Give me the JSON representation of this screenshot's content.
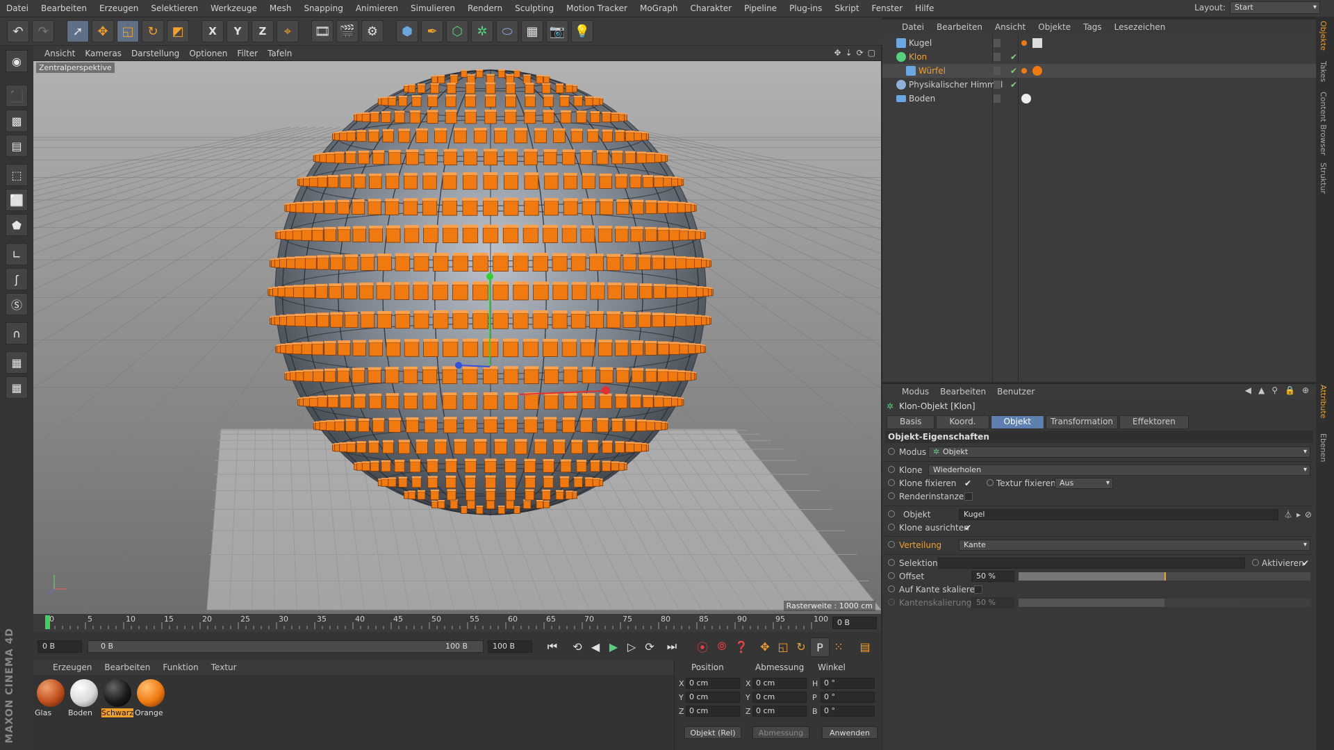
{
  "menubar": {
    "items": [
      "Datei",
      "Bearbeiten",
      "Erzeugen",
      "Selektieren",
      "Werkzeuge",
      "Mesh",
      "Snapping",
      "Animieren",
      "Simulieren",
      "Rendern",
      "Sculpting",
      "Motion Tracker",
      "MoGraph",
      "Charakter",
      "Pipeline",
      "Plug-ins",
      "Skript",
      "Fenster",
      "Hilfe"
    ],
    "layout_label": "Layout:",
    "layout_value": "Start"
  },
  "toolbar": {
    "icons": [
      "undo-icon",
      "redo-icon",
      "live-select-icon",
      "move-icon",
      "scale-icon",
      "rotate-icon",
      "recent-tool-icon",
      "x-axis-icon",
      "y-axis-icon",
      "z-axis-icon",
      "coordinate-system-icon",
      "render-view-icon",
      "render-picture-viewer-icon",
      "edit-render-settings-icon",
      "cube-icon",
      "pen-icon",
      "subdivision-icon",
      "cloner-icon",
      "deformer-icon",
      "floor-icon",
      "camera-icon",
      "light-icon"
    ],
    "axis_x": "X",
    "axis_y": "Y",
    "axis_z": "Z"
  },
  "viewport": {
    "menu": [
      "Ansicht",
      "Kameras",
      "Darstellung",
      "Optionen",
      "Filter",
      "Tafeln"
    ],
    "label": "Zentralperspektive",
    "raster": "Rasterweite : 1000 cm",
    "accent": "#f07a10",
    "axis_colors": {
      "x": "#e03030",
      "y": "#30d030",
      "z": "#3050e0"
    }
  },
  "timeline": {
    "ticks": [
      "0",
      "5",
      "10",
      "15",
      "20",
      "25",
      "30",
      "35",
      "40",
      "45",
      "50",
      "55",
      "60",
      "65",
      "70",
      "75",
      "80",
      "85",
      "90",
      "95",
      "100"
    ],
    "current_frame_box": "0 B",
    "start_field": "0 B",
    "range_start": "0 B",
    "range_end": "100 B",
    "end_field": "100 B"
  },
  "material_manager": {
    "menu": [
      "Erzeugen",
      "Bearbeiten",
      "Funktion",
      "Textur"
    ],
    "materials": [
      {
        "name": "Glas",
        "color": "#c0501c",
        "selected": false
      },
      {
        "name": "Boden",
        "color": "#e8e8e8",
        "selected": false
      },
      {
        "name": "Schwarz",
        "color": "#1a1a1a",
        "selected": true
      },
      {
        "name": "Orange",
        "color": "#f07a10",
        "selected": false
      }
    ]
  },
  "coordinates": {
    "headers": [
      "Position",
      "Abmessung",
      "Winkel"
    ],
    "rows": [
      {
        "a": "X",
        "av": "0 cm",
        "b": "X",
        "bv": "0 cm",
        "c": "H",
        "cv": "0 °"
      },
      {
        "a": "Y",
        "av": "0 cm",
        "b": "Y",
        "bv": "0 cm",
        "c": "P",
        "cv": "0 °"
      },
      {
        "a": "Z",
        "av": "0 cm",
        "b": "Z",
        "bv": "0 cm",
        "c": "B",
        "cv": "0 °"
      }
    ],
    "mode": "Objekt (Rel)",
    "size_mode": "Abmessung",
    "apply": "Anwenden"
  },
  "object_manager": {
    "menu": [
      "Datei",
      "Bearbeiten",
      "Ansicht",
      "Objekte",
      "Tags",
      "Lesezeichen"
    ],
    "objects": [
      {
        "name": "Kugel",
        "color": "#cfcfcf",
        "indent": 0
      },
      {
        "name": "Klon",
        "color": "#f2a02a",
        "indent": 0
      },
      {
        "name": "Würfel",
        "color": "#f2a02a",
        "indent": 1
      },
      {
        "name": "Physikalischer Himmel",
        "color": "#cfcfcf",
        "indent": 0
      },
      {
        "name": "Boden",
        "color": "#cfcfcf",
        "indent": 0
      }
    ]
  },
  "attribute_manager": {
    "menu": [
      "Modus",
      "Bearbeiten",
      "Benutzer"
    ],
    "title": "Klon-Objekt [Klon]",
    "tabs": [
      "Basis",
      "Koord.",
      "Objekt",
      "Transformation",
      "Effektoren"
    ],
    "active_tab": "Objekt",
    "section": "Objekt-Eigenschaften",
    "modus_label": "Modus",
    "modus_value": "Objekt",
    "klone_label": "Klone",
    "klone_value": "Wiederholen",
    "klone_fixieren": "Klone fixieren",
    "textur_fixieren": "Textur fixieren",
    "textur_value": "Aus",
    "renderinstanzen": "Renderinstanzen",
    "objekt_label": "Objekt",
    "objekt_value": "Kugel",
    "klone_ausrichten": "Klone ausrichten",
    "verteilung_label": "Verteilung",
    "verteilung_value": "Kante",
    "selektion_label": "Selektion",
    "aktivieren_label": "Aktivieren",
    "offset_label": "Offset",
    "offset_value": "50 %",
    "offset_fraction": 0.5,
    "auf_kante_skalieren": "Auf Kante skalieren",
    "kantenskalierung_label": "Kantenskalierung",
    "kantenskalierung_value": "50 %",
    "kantenskalierung_fraction": 0.5
  },
  "side_tabs": [
    "Objekte",
    "Takes",
    "Content Browser",
    "Struktur",
    "Attribute",
    "Ebenen"
  ],
  "brand": "MAXON CINEMA 4D"
}
